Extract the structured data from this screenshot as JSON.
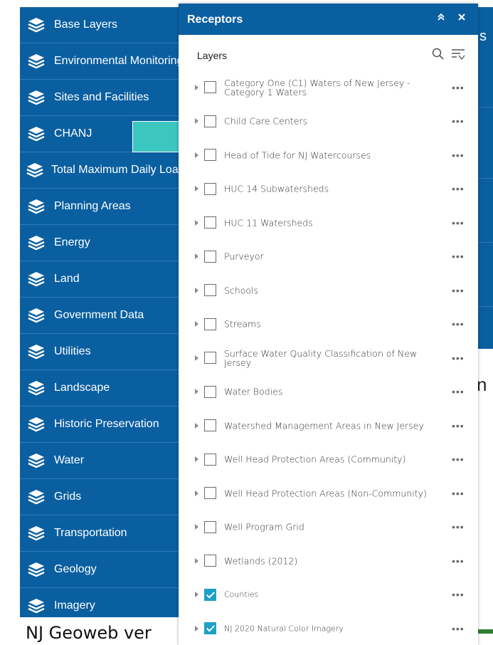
{
  "sidebar": {
    "items": [
      {
        "label": "Base Layers"
      },
      {
        "label": "Environmental Monitoring"
      },
      {
        "label": "Sites and Facilities"
      },
      {
        "label": "CHANJ"
      },
      {
        "label": "Total Maximum Daily Load"
      },
      {
        "label": "Planning Areas"
      },
      {
        "label": "Energy"
      },
      {
        "label": " Land"
      },
      {
        "label": "Government Data"
      },
      {
        "label": "Utilities"
      },
      {
        "label": "Landscape"
      },
      {
        "label": "Historic Preservation"
      },
      {
        "label": " Water"
      },
      {
        "label": " Grids"
      },
      {
        "label": "Transportation"
      },
      {
        "label": "Geology"
      },
      {
        "label": "Imagery"
      }
    ]
  },
  "panel": {
    "title": "Receptors",
    "layers_label": "Layers",
    "layers": [
      {
        "name": "Category One (C1) Waters of New Jersey - Category 1 Waters",
        "checked": false
      },
      {
        "name": "Child Care Centers",
        "checked": false
      },
      {
        "name": "Head of Tide for NJ Watercourses",
        "checked": false
      },
      {
        "name": "HUC 14 Subwatersheds",
        "checked": false
      },
      {
        "name": "HUC 11 Watersheds",
        "checked": false
      },
      {
        "name": "Purveyor",
        "checked": false
      },
      {
        "name": "Schools",
        "checked": false
      },
      {
        "name": "Streams",
        "checked": false
      },
      {
        "name": "Surface Water Quality Classification of New Jersey",
        "checked": false
      },
      {
        "name": "Water Bodies",
        "checked": false
      },
      {
        "name": "Watershed Management Areas in New Jersey",
        "checked": false
      },
      {
        "name": "Well Head Protection Areas (Community)",
        "checked": false
      },
      {
        "name": "Well Head Protection Areas (Non-Community)",
        "checked": false
      },
      {
        "name": "Well Program Grid",
        "checked": false
      },
      {
        "name": "Wetlands (2012)",
        "checked": false
      },
      {
        "name": "Counties",
        "checked": true
      },
      {
        "name": "NJ 2020 Natural Color Imagery",
        "checked": true
      }
    ],
    "more_glyph": "•••"
  },
  "background": {
    "footer_text": "NJ Geoweb ver",
    "right_letter_s": "s",
    "right_letter_n": "n"
  },
  "colors": {
    "sidebar_bg": "#0a5fa0",
    "accent_check": "#1da0c7",
    "teal": "#3cc6c0"
  },
  "icons": {
    "sidebar_item": "layers-stack-icon",
    "collapse": "double-chevron-up-icon",
    "close": "close-icon",
    "search": "search-icon",
    "filter": "filter-list-icon",
    "expand": "caret-right-icon",
    "more": "ellipsis-icon"
  }
}
